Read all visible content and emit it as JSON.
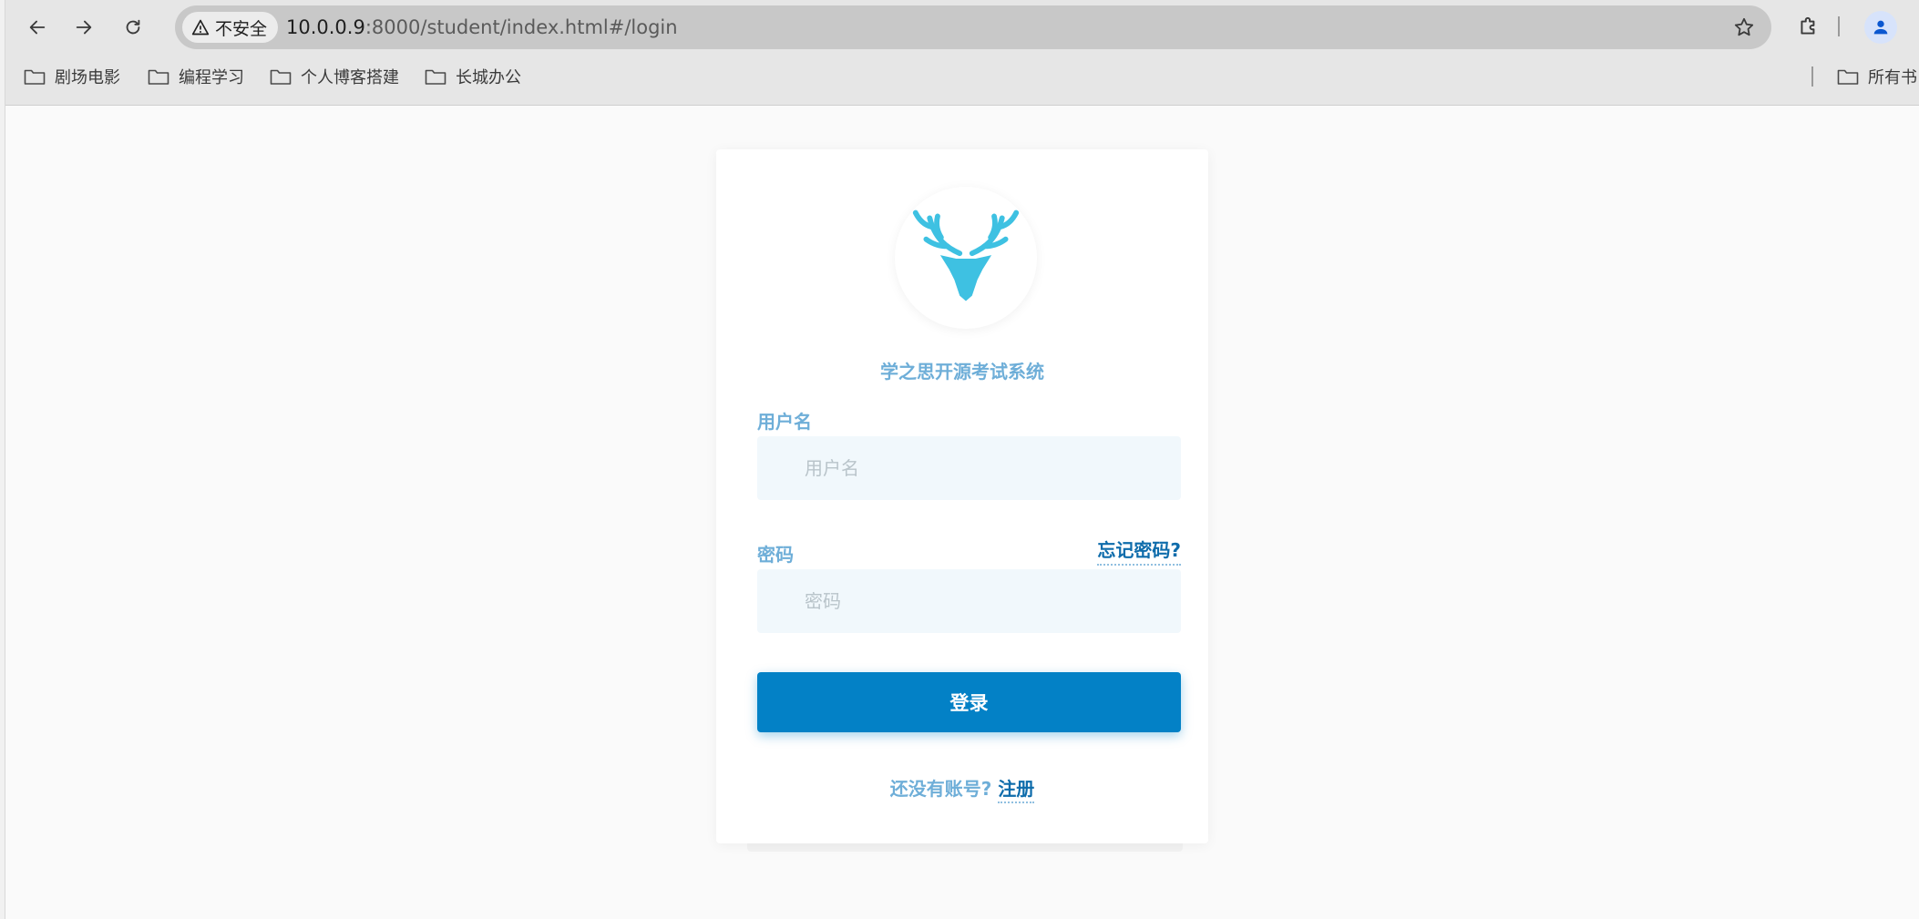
{
  "browser": {
    "security_label": "不安全",
    "url_host": "10.0.0.9",
    "url_rest": ":8000/student/index.html#/login",
    "bookmarks": [
      {
        "label": "剧场电影"
      },
      {
        "label": "编程学习"
      },
      {
        "label": "个人博客搭建"
      },
      {
        "label": "长城办公"
      }
    ],
    "all_bookmarks_label": "所有书"
  },
  "login": {
    "system_title": "学之思开源考试系统",
    "username_label": "用户名",
    "username_placeholder": "用户名",
    "password_label": "密码",
    "password_placeholder": "密码",
    "forgot_password": "忘记密码?",
    "login_button": "登录",
    "register_prompt": "还没有账号?",
    "register_link": "注册"
  },
  "colors": {
    "accent": "#0381c6",
    "label": "#6eaed8",
    "link": "#0e6cab",
    "logo": "#3ec1e2"
  },
  "icons": {
    "logo": "deer-head-icon",
    "security": "warning-triangle-icon"
  }
}
